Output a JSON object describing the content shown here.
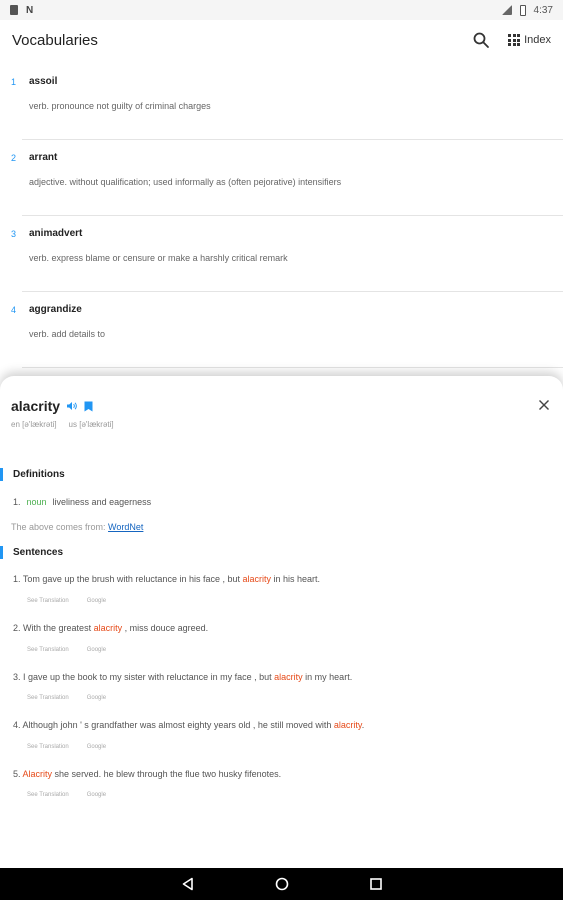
{
  "status_bar": {
    "time": "4:37",
    "notif_letter": "N"
  },
  "app_bar": {
    "title": "Vocabularies",
    "index_label": "Index"
  },
  "vocab": [
    {
      "num": "1",
      "word": "assoil",
      "definition": "verb. pronounce not guilty of criminal charges"
    },
    {
      "num": "2",
      "word": "arrant",
      "definition": "adjective. without qualification; used informally as (often pejorative) intensifiers"
    },
    {
      "num": "3",
      "word": "animadvert",
      "definition": "verb. express blame or censure or make a harshly critical remark"
    },
    {
      "num": "4",
      "word": "aggrandize",
      "definition": "verb. add details to"
    }
  ],
  "sheet": {
    "word": "alacrity",
    "phonetic_en": "en [ə'lækrəti]",
    "phonetic_us": "us [ə'lækrəti]",
    "definitions_title": "Definitions",
    "definition_num": "1.",
    "definition_pos": "noun",
    "definition_text": "liveliness and eagerness",
    "source_prefix": "The above comes from: ",
    "source_name": "WordNet",
    "sentences_title": "Sentences",
    "see_translation": "See Translation",
    "google": "Google",
    "sentences": [
      {
        "num": "1.",
        "pre": "Tom gave up the brush with reluctance in his face , but ",
        "hl": "alacrity",
        "post": " in his heart."
      },
      {
        "num": "2.",
        "pre": "With the greatest ",
        "hl": "alacrity",
        "post": " , miss douce agreed."
      },
      {
        "num": "3.",
        "pre": "I gave up the book to my sister with reluctance in my face , but ",
        "hl": "alacrity",
        "post": " in my heart."
      },
      {
        "num": "4.",
        "pre": "Although john ' s grandfather was almost eighty years old , he still moved with ",
        "hl": "alacrity",
        "post": "."
      },
      {
        "num": "5.",
        "pre": "",
        "hl": "Alacrity",
        "post": " she served. he blew through the flue two husky fifenotes."
      }
    ]
  },
  "colors": {
    "accent": "#2196f3",
    "highlight": "#e64a19",
    "pos": "#4caf50",
    "link": "#1565c0"
  }
}
